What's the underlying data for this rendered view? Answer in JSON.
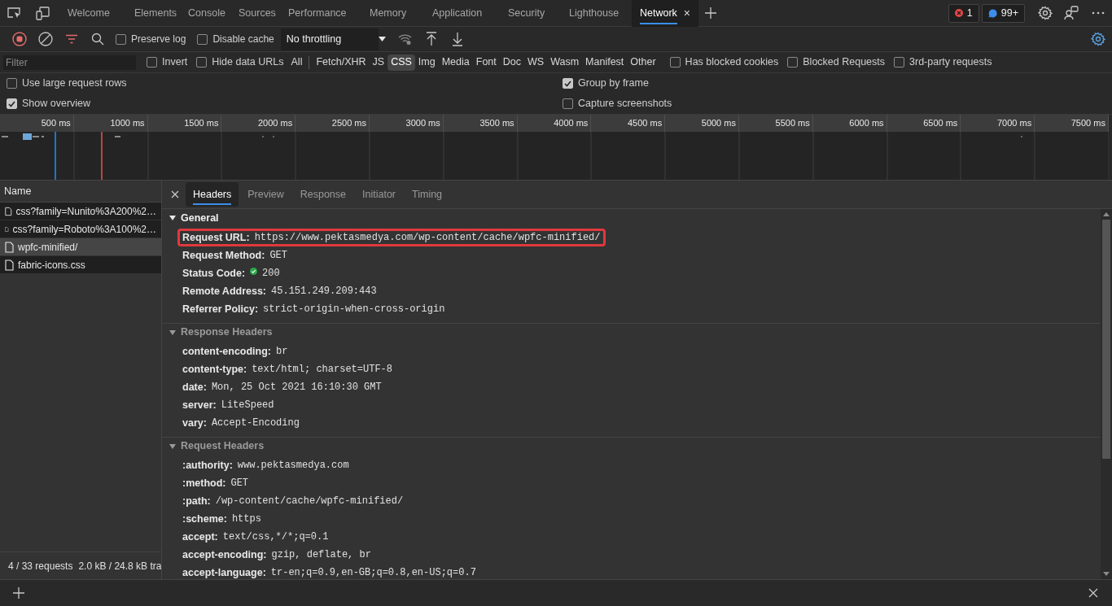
{
  "top_tabs": [
    {
      "label": "Welcome",
      "selected": false
    },
    {
      "label": "Elements",
      "selected": false
    },
    {
      "label": "Console",
      "selected": false
    },
    {
      "label": "Sources",
      "selected": false
    },
    {
      "label": "Performance",
      "selected": false
    },
    {
      "label": "Memory",
      "selected": false
    },
    {
      "label": "Application",
      "selected": false
    },
    {
      "label": "Security",
      "selected": false
    },
    {
      "label": "Lighthouse",
      "selected": false
    },
    {
      "label": "Network",
      "selected": true
    }
  ],
  "close_glyph": "×",
  "badges": [
    {
      "kind": "error",
      "count": "1"
    },
    {
      "kind": "issue",
      "count": "99+"
    }
  ],
  "toolbar": {
    "checkboxes": [
      {
        "label": "Preserve log",
        "checked": false
      },
      {
        "label": "Disable cache",
        "checked": false
      }
    ],
    "throttling": "No throttling"
  },
  "filter": {
    "placeholder": "Filter",
    "options": [
      {
        "label": "Invert",
        "checked": false
      },
      {
        "label": "Hide data URLs",
        "checked": false
      }
    ],
    "types": [
      {
        "label": "All",
        "selected": false
      },
      {
        "label": "Fetch/XHR",
        "selected": false
      },
      {
        "label": "JS",
        "selected": false
      },
      {
        "label": "CSS",
        "selected": true
      },
      {
        "label": "Img",
        "selected": false
      },
      {
        "label": "Media",
        "selected": false
      },
      {
        "label": "Font",
        "selected": false
      },
      {
        "label": "Doc",
        "selected": false
      },
      {
        "label": "WS",
        "selected": false
      },
      {
        "label": "Wasm",
        "selected": false
      },
      {
        "label": "Manifest",
        "selected": false
      },
      {
        "label": "Other",
        "selected": false
      }
    ],
    "extra": [
      {
        "label": "Has blocked cookies",
        "checked": false
      },
      {
        "label": "Blocked Requests",
        "checked": false
      },
      {
        "label": "3rd-party requests",
        "checked": false
      }
    ]
  },
  "settings": {
    "left": [
      {
        "label": "Use large request rows",
        "checked": false
      },
      {
        "label": "Show overview",
        "checked": true
      }
    ],
    "right": [
      {
        "label": "Group by frame",
        "checked": true
      },
      {
        "label": "Capture screenshots",
        "checked": false
      }
    ]
  },
  "overview": {
    "ticks": [
      "500 ms",
      "1000 ms",
      "1500 ms",
      "2000 ms",
      "2500 ms",
      "3000 ms",
      "3500 ms",
      "4000 ms",
      "4500 ms",
      "5000 ms",
      "5500 ms",
      "6000 ms",
      "6500 ms",
      "7000 ms",
      "7500 ms"
    ]
  },
  "requests": {
    "column": "Name",
    "rows": [
      {
        "name": "css?family=Nunito%3A200%2…",
        "selected": false
      },
      {
        "name": "css?family=Roboto%3A100%2…",
        "selected": false
      },
      {
        "name": "wpfc-minified/",
        "selected": true
      },
      {
        "name": "fabric-icons.css",
        "selected": false
      }
    ],
    "summary": [
      "4 / 33 requests",
      "2.0 kB / 24.8 kB tra"
    ]
  },
  "details": {
    "tabs": [
      {
        "label": "Headers",
        "selected": true
      },
      {
        "label": "Preview",
        "selected": false
      },
      {
        "label": "Response",
        "selected": false
      },
      {
        "label": "Initiator",
        "selected": false
      },
      {
        "label": "Timing",
        "selected": false
      }
    ],
    "sections": [
      {
        "title": "General",
        "focused": true,
        "headers": [
          {
            "name": "Request URL:",
            "value": "https://www.pektasmedya.com/wp-content/cache/wpfc-minified/",
            "outlined": true
          },
          {
            "name": "Request Method:",
            "value": "GET"
          },
          {
            "name": "Status Code:",
            "value": "200",
            "status_ok": true
          },
          {
            "name": "Remote Address:",
            "value": "45.151.249.209:443"
          },
          {
            "name": "Referrer Policy:",
            "value": "strict-origin-when-cross-origin"
          }
        ]
      },
      {
        "title": "Response Headers",
        "focused": false,
        "headers": [
          {
            "name": "content-encoding:",
            "value": "br"
          },
          {
            "name": "content-type:",
            "value": "text/html; charset=UTF-8"
          },
          {
            "name": "date:",
            "value": "Mon, 25 Oct 2021 16:10:30 GMT"
          },
          {
            "name": "server:",
            "value": "LiteSpeed"
          },
          {
            "name": "vary:",
            "value": "Accept-Encoding"
          }
        ]
      },
      {
        "title": "Request Headers",
        "focused": false,
        "headers": [
          {
            "name": ":authority:",
            "value": "www.pektasmedya.com"
          },
          {
            "name": ":method:",
            "value": "GET"
          },
          {
            "name": ":path:",
            "value": "/wp-content/cache/wpfc-minified/"
          },
          {
            "name": ":scheme:",
            "value": "https"
          },
          {
            "name": "accept:",
            "value": "text/css,*/*;q=0.1"
          },
          {
            "name": "accept-encoding:",
            "value": "gzip, deflate, br"
          },
          {
            "name": "accept-language:",
            "value": "tr-en;q=0.9,en-GB;q=0.8,en-US;q=0.7"
          }
        ]
      }
    ]
  }
}
